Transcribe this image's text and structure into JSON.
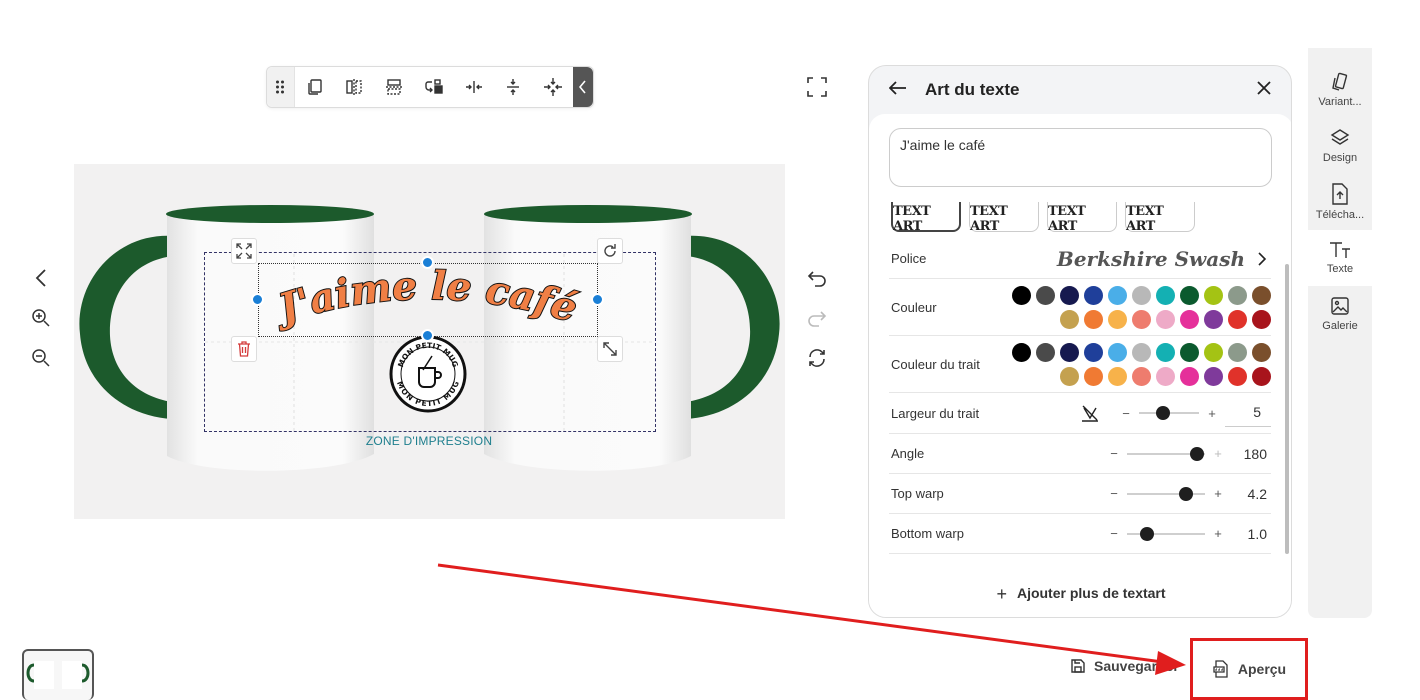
{
  "toolbar": {
    "tools": [
      "drag-handle-icon",
      "duplicate-icon",
      "flip-horizontal-icon",
      "flip-vertical-icon",
      "layer-order-icon",
      "center-horizontal-icon",
      "center-vertical-icon",
      "center-both-icon"
    ]
  },
  "canvas": {
    "zone_label": "ZONE D'IMPRESSION",
    "art_text": "J'aime le café",
    "logo_text_top": "MON PETIT MUG",
    "logo_text_bottom": "MON PETIT MUG",
    "mug_handle_color": "#1c5a2c",
    "art_text_fill": "#f07f45"
  },
  "panel": {
    "title": "Art du texte",
    "text_value": "J'aime le café",
    "styles": [
      {
        "label": "TEXT ART",
        "selected": true
      },
      {
        "label": "TEXT ART",
        "selected": false
      },
      {
        "label": "TEXT ART",
        "selected": false
      },
      {
        "label": "TEXT ART",
        "selected": false
      }
    ],
    "font": {
      "label": "Police",
      "value": "Berkshire Swash"
    },
    "color": {
      "label": "Couleur",
      "swatches": [
        "#000000",
        "#4a4a4a",
        "#16194f",
        "#1f3f9a",
        "#4aaee8",
        "#b8b8b8",
        "#14b0b3",
        "#0b5a2e",
        "#a4c314",
        "#8c9a8b",
        "#7a4f2c",
        "#c4a14f",
        "#f07a33",
        "#f7b24a",
        "#ee7c6e",
        "#eeaac7",
        "#e5309a",
        "#7f3a9b",
        "#e0322a",
        "#a8141c"
      ]
    },
    "stroke_color": {
      "label": "Couleur du trait",
      "swatches": [
        "#000000",
        "#4a4a4a",
        "#16194f",
        "#1f3f9a",
        "#4aaee8",
        "#b8b8b8",
        "#14b0b3",
        "#0b5a2e",
        "#a4c314",
        "#8c9a8b",
        "#7a4f2c",
        "#c4a14f",
        "#f07a33",
        "#f7b24a",
        "#ee7c6e",
        "#eeaac7",
        "#e5309a",
        "#7f3a9b",
        "#e0322a",
        "#a8141c"
      ]
    },
    "stroke_width": {
      "label": "Largeur du trait",
      "value": "5",
      "level": 0.4
    },
    "angle": {
      "label": "Angle",
      "value": "180",
      "level": 0.9
    },
    "top_warp": {
      "label": "Top warp",
      "value": "4.2",
      "level": 0.75
    },
    "bottom_warp": {
      "label": "Bottom warp",
      "value": "1.0",
      "level": 0.25
    },
    "add_more": "Ajouter plus de textart",
    "minus": "−",
    "plus": "+"
  },
  "rail": {
    "items": [
      {
        "label": "Variant...",
        "icon": "variant-icon"
      },
      {
        "label": "Design",
        "icon": "layers-icon"
      },
      {
        "label": "Télécha...",
        "icon": "upload-icon"
      },
      {
        "label": "Texte",
        "icon": "text-icon"
      },
      {
        "label": "Galerie",
        "icon": "image-icon"
      }
    ]
  },
  "footer": {
    "save_label": "Sauvegarder",
    "preview_label": "Aperçu"
  },
  "colors": {
    "accent_blue": "#1a7fd6",
    "highlight_red": "#e01e1e"
  }
}
